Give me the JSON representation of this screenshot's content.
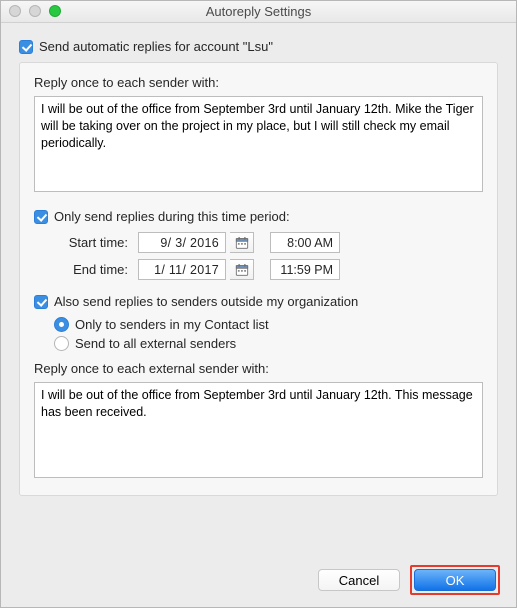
{
  "window": {
    "title": "Autoreply Settings"
  },
  "main_checkbox_label": "Send automatic replies for account \"Lsu\"",
  "reply_section_label": "Reply once to each sender with:",
  "reply_message": "I will be out of the office from September 3rd until January 12th. Mike the Tiger will be taking over on the project in my place, but I will still check my email periodically.",
  "time_period_checkbox_label": "Only send replies during this time period:",
  "start_label": "Start time:",
  "end_label": "End time:",
  "start_date": "9/  3/ 2016",
  "start_time": "8:00 AM",
  "end_date": "1/ 11/ 2017",
  "end_time": "11:59 PM",
  "external_checkbox_label": "Also send replies to senders outside my organization",
  "radio_contacts_label": "Only to senders in my Contact list",
  "radio_all_label": "Send to all external senders",
  "external_section_label": "Reply once to each external sender with:",
  "external_reply_message": "I will be out of the office from September 3rd until January 12th. This message has been received. ",
  "buttons": {
    "cancel": "Cancel",
    "ok": "OK"
  },
  "states": {
    "send_auto_replies": true,
    "time_period_enabled": true,
    "external_enabled": true,
    "external_scope": "contacts"
  }
}
